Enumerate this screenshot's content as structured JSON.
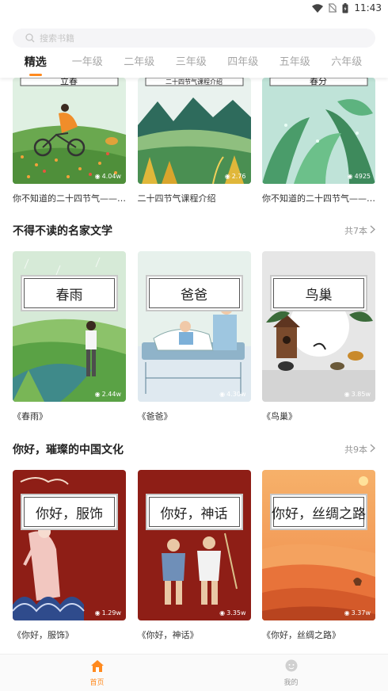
{
  "status_bar": {
    "time": "11:43"
  },
  "search": {
    "placeholder": "搜索书籍"
  },
  "tabs": [
    "精选",
    "一年级",
    "二年级",
    "三年级",
    "四年级",
    "五年级",
    "六年级"
  ],
  "top_row": [
    {
      "plate": "立春",
      "plays": "4.04w",
      "title": "你不知道的二十四节气——立春"
    },
    {
      "plate": "二十四节气课程介绍",
      "plays": "2.76",
      "title": "二十四节气课程介绍"
    },
    {
      "plate": "春分",
      "plays": "4925",
      "title": "你不知道的二十四节气——春分"
    }
  ],
  "sections": [
    {
      "title": "不得不读的名家文学",
      "more": "共7本",
      "books": [
        {
          "plate": "春雨",
          "plays": "2.44w",
          "title": "《春雨》"
        },
        {
          "plate": "爸爸",
          "plays": "4.30w",
          "title": "《爸爸》"
        },
        {
          "plate": "鸟巢",
          "plays": "3.85w",
          "title": "《鸟巢》"
        }
      ]
    },
    {
      "title": "你好，璀璨的中国文化",
      "more": "共9本",
      "books": [
        {
          "plate": "你好，服饰",
          "plays": "1.29w",
          "title": "《你好，服饰》"
        },
        {
          "plate": "你好，神话",
          "plays": "3.35w",
          "title": "《你好，神话》"
        },
        {
          "plate": "你好，丝绸之路",
          "plays": "3.37w",
          "title": "《你好，丝绸之路》"
        }
      ]
    }
  ],
  "bottom_nav": {
    "home": "首页",
    "mine": "我的"
  },
  "colors": {
    "accent": "#ff8a1f",
    "culture_bg": "#8e1e16"
  }
}
